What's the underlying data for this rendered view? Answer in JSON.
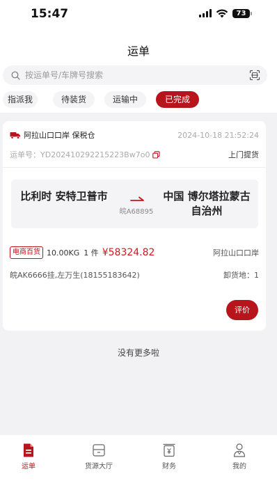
{
  "status_bar": {
    "time": "15:47",
    "battery": "73"
  },
  "header": {
    "title": "运单"
  },
  "search": {
    "placeholder": "按运单号/车牌号搜索"
  },
  "tabs": [
    {
      "label": "指派我",
      "active": false
    },
    {
      "label": "待装货",
      "active": false
    },
    {
      "label": "运输中",
      "active": false
    },
    {
      "label": "已完成",
      "active": true
    }
  ],
  "order": {
    "company": "阿拉山口口岸 保税仓",
    "time": "2024-10-18 21:52:24",
    "order_no": "运单号：YD202410292215223Bw7o0",
    "pickup": "上门提货",
    "route": {
      "from": "比利时 安特卫普市",
      "to": "中国 博尔塔拉蒙古自治州",
      "plate": "皖A68895"
    },
    "cargo": {
      "tag": "电商百货",
      "weight": "10.00KG",
      "qty": "1 件",
      "price": "¥58324.82",
      "dest": "阿拉山口口岸"
    },
    "driver": "皖AK6666挂,左万生(18155183642)",
    "unload": "卸货地：1",
    "rate_label": "评价"
  },
  "list_footer": "没有更多啦",
  "tabbar": [
    {
      "label": "运单",
      "icon": "waybill-icon",
      "active": true
    },
    {
      "label": "货源大厅",
      "icon": "cargo-hall-icon",
      "active": false
    },
    {
      "label": "财务",
      "icon": "finance-icon",
      "active": false
    },
    {
      "label": "我的",
      "icon": "profile-icon",
      "active": false
    }
  ],
  "colors": {
    "accent": "#b8141c",
    "price": "#d4151e",
    "background": "#f2f2f4"
  }
}
